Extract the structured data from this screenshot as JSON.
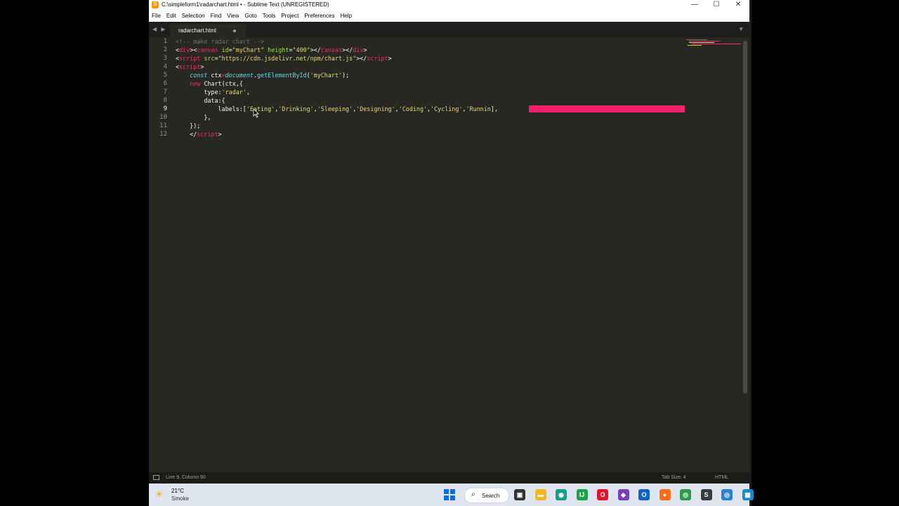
{
  "window": {
    "title": "C:\\simpleform1\\radarchart.html • - Sublime Text (UNREGISTERED)",
    "controls": {
      "minimize": "—",
      "maximize": "☐",
      "close": "✕"
    }
  },
  "menu": [
    "File",
    "Edit",
    "Selection",
    "Find",
    "View",
    "Goto",
    "Tools",
    "Project",
    "Preferences",
    "Help"
  ],
  "tab": {
    "name": "radarchart.html",
    "modified": true
  },
  "editor": {
    "line_numbers": [
      "1",
      "2",
      "3",
      "4",
      "5",
      "6",
      "7",
      "8",
      "9",
      "10",
      "11",
      "12"
    ],
    "active_line": 9,
    "lines": [
      [
        {
          "t": "<!-- make radar chart -->",
          "c": "cm"
        }
      ],
      [
        {
          "t": "<",
          "c": "p"
        },
        {
          "t": "div",
          "c": "tg"
        },
        {
          "t": "><",
          "c": "p"
        },
        {
          "t": "canvas",
          "c": "tg"
        },
        {
          "t": " ",
          "c": "p"
        },
        {
          "t": "id",
          "c": "at"
        },
        {
          "t": "=",
          "c": "p"
        },
        {
          "t": "\"myChart\"",
          "c": "st"
        },
        {
          "t": " ",
          "c": "p"
        },
        {
          "t": "height",
          "c": "at"
        },
        {
          "t": "=",
          "c": "p"
        },
        {
          "t": "\"400\"",
          "c": "st"
        },
        {
          "t": "></",
          "c": "p"
        },
        {
          "t": "canvas",
          "c": "tg"
        },
        {
          "t": "></",
          "c": "p"
        },
        {
          "t": "div",
          "c": "tg"
        },
        {
          "t": ">",
          "c": "p"
        }
      ],
      [
        {
          "t": "<",
          "c": "p"
        },
        {
          "t": "script",
          "c": "tg"
        },
        {
          "t": " ",
          "c": "p"
        },
        {
          "t": "src",
          "c": "at"
        },
        {
          "t": "=",
          "c": "p"
        },
        {
          "t": "\"https://cdn.jsdelivr.net/npm/chart.js\"",
          "c": "st"
        },
        {
          "t": "></",
          "c": "p"
        },
        {
          "t": "script",
          "c": "tg"
        },
        {
          "t": ">",
          "c": "p"
        }
      ],
      [
        {
          "t": "<",
          "c": "p"
        },
        {
          "t": "script",
          "c": "tg"
        },
        {
          "t": ">",
          "c": "p"
        }
      ],
      [
        {
          "t": "    ",
          "c": "p"
        },
        {
          "t": "const",
          "c": "kw"
        },
        {
          "t": " ctx",
          "c": "p"
        },
        {
          "t": "=",
          "c": "kr"
        },
        {
          "t": "document",
          "c": "it"
        },
        {
          "t": ".",
          "c": "p"
        },
        {
          "t": "getElementById",
          "c": "fn"
        },
        {
          "t": "(",
          "c": "p"
        },
        {
          "t": "'myChart'",
          "c": "st"
        },
        {
          "t": ");",
          "c": "p"
        }
      ],
      [
        {
          "t": "    ",
          "c": "p"
        },
        {
          "t": "new",
          "c": "kr"
        },
        {
          "t": " Chart(ctx,{",
          "c": "p"
        }
      ],
      [
        {
          "t": "        type:",
          "c": "p"
        },
        {
          "t": "'radar'",
          "c": "st"
        },
        {
          "t": ",",
          "c": "p"
        }
      ],
      [
        {
          "t": "        data:{",
          "c": "p"
        }
      ],
      [
        {
          "t": "            labels:[",
          "c": "p"
        },
        {
          "t": "'Eating'",
          "c": "st"
        },
        {
          "t": ",",
          "c": "p"
        },
        {
          "t": "'Drinking'",
          "c": "st"
        },
        {
          "t": ",",
          "c": "p"
        },
        {
          "t": "'Sleeping'",
          "c": "st"
        },
        {
          "t": ",",
          "c": "p"
        },
        {
          "t": "'Designing'",
          "c": "st"
        },
        {
          "t": ",",
          "c": "p"
        },
        {
          "t": "'Coding'",
          "c": "st"
        },
        {
          "t": ",",
          "c": "p"
        },
        {
          "t": "'Cycling'",
          "c": "st"
        },
        {
          "t": ",",
          "c": "p"
        },
        {
          "t": "'Runnin",
          "c": "st"
        },
        {
          "t": "],",
          "c": "p"
        }
      ],
      [
        {
          "t": "        },",
          "c": "p"
        }
      ],
      [
        {
          "t": "    });",
          "c": "p"
        }
      ],
      [
        {
          "t": "    </",
          "c": "p"
        },
        {
          "t": "script",
          "c": "tg"
        },
        {
          "t": ">",
          "c": "p"
        }
      ]
    ]
  },
  "status": {
    "position": "Line 9, Column 90",
    "tab_size": "Tab Size: 4",
    "syntax": "HTML"
  },
  "taskbar": {
    "weather": {
      "temp": "21°C",
      "condition": "Smoke"
    },
    "search_label": "Search",
    "apps": [
      {
        "name": "task-view-icon",
        "glyph": "▣",
        "color": "#333333"
      },
      {
        "name": "file-explorer-icon",
        "glyph": "▬",
        "color": "#f2b824"
      },
      {
        "name": "edge-icon",
        "glyph": "◉",
        "color": "#1c9a8a"
      },
      {
        "name": "intellij-icon",
        "glyph": "IJ",
        "color": "#1aa24a"
      },
      {
        "name": "opera-icon",
        "glyph": "O",
        "color": "#e5142e"
      },
      {
        "name": "visual-studio-icon",
        "glyph": "◆",
        "color": "#7b3fb8"
      },
      {
        "name": "outlook-icon",
        "glyph": "O",
        "color": "#0f64c5"
      },
      {
        "name": "firefox-icon",
        "glyph": "●",
        "color": "#ff6a1a"
      },
      {
        "name": "chrome-icon",
        "glyph": "◎",
        "color": "#2f9a4a"
      },
      {
        "name": "sublime-text-icon",
        "glyph": "S",
        "color": "#3a3a3a"
      },
      {
        "name": "chrome-profile-icon",
        "glyph": "◎",
        "color": "#2f7fd4"
      },
      {
        "name": "app-icon",
        "glyph": "▦",
        "color": "#1a8ad0"
      }
    ]
  },
  "colors": {
    "selection_highlight": "#f4206b",
    "background": "#272822"
  }
}
